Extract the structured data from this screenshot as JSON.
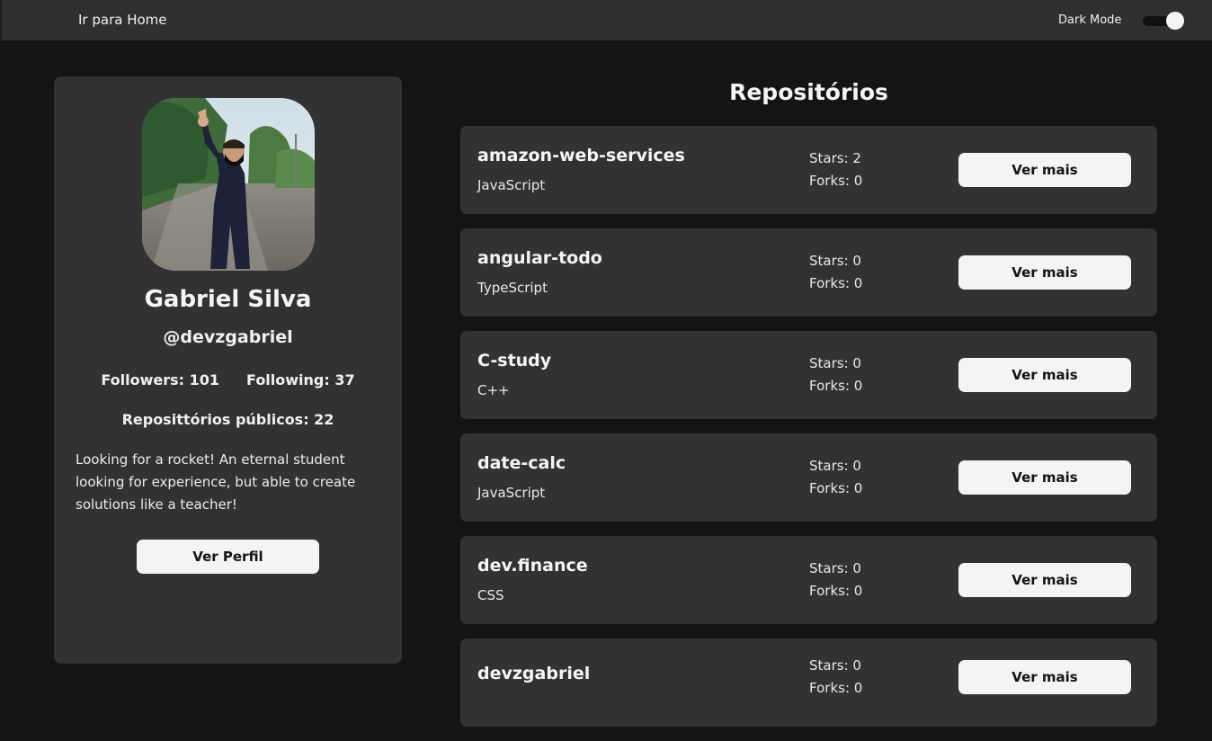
{
  "nav": {
    "home_link": "Ir para Home",
    "dark_mode_label": "Dark Mode",
    "dark_mode_on": true
  },
  "profile": {
    "name": "Gabriel Silva",
    "handle": "@devzgabriel",
    "followers": "Followers: 101",
    "following": "Following: 37",
    "public_repos": "Reposittórios públicos: 22",
    "bio": "Looking for a rocket! An eternal student looking for experience, but able to create solutions like a teacher!",
    "button_label": "Ver Perfil"
  },
  "repos": {
    "title": "Repositórios",
    "items": [
      {
        "name": "amazon-web-services",
        "language": "JavaScript",
        "stars": "Stars: 2",
        "forks": "Forks: 0",
        "button": "Ver mais"
      },
      {
        "name": "angular-todo",
        "language": "TypeScript",
        "stars": "Stars: 0",
        "forks": "Forks: 0",
        "button": "Ver mais"
      },
      {
        "name": "C-study",
        "language": "C++",
        "stars": "Stars: 0",
        "forks": "Forks: 0",
        "button": "Ver mais"
      },
      {
        "name": "date-calc",
        "language": "JavaScript",
        "stars": "Stars: 0",
        "forks": "Forks: 0",
        "button": "Ver mais"
      },
      {
        "name": "dev.finance",
        "language": "CSS",
        "stars": "Stars: 0",
        "forks": "Forks: 0",
        "button": "Ver mais"
      },
      {
        "name": "devzgabriel",
        "language": "",
        "stars": "Stars: 0",
        "forks": "Forks: 0",
        "button": "Ver mais"
      }
    ]
  },
  "colors": {
    "background": "#141414",
    "topbar": "#2f2f2f",
    "card": "#323232",
    "button": "#f4f4f4",
    "button_text": "#141414"
  }
}
